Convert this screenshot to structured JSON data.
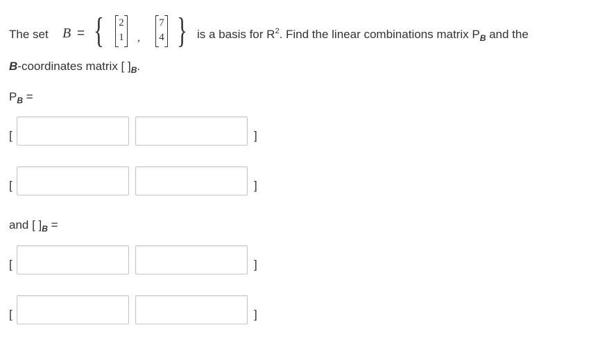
{
  "question": {
    "prefix": "The set",
    "set_symbol": "B",
    "equals": "=",
    "vector1": [
      "2",
      "1"
    ],
    "vector2": [
      "7",
      "4"
    ],
    "comma": ",",
    "basis_text_1": "is a basis for R",
    "basis_sup": "2",
    "basis_text_2": ".  Find the linear combinations matrix P",
    "basis_sub": "B",
    "basis_text_3": " and the",
    "line2_b": "B",
    "line2_text": "-coordinates matrix [ ]",
    "line2_sub": "B",
    "line2_end": "."
  },
  "pb_label": {
    "p": "P",
    "sub": "B",
    "eq": " ="
  },
  "coord_label": {
    "text": "and [ ]",
    "sub": "B",
    "eq": " ="
  },
  "brackets": {
    "open": "[",
    "close": "]"
  },
  "inputs": {
    "pb_r1c1": "",
    "pb_r1c2": "",
    "pb_r2c1": "",
    "pb_r2c2": "",
    "cb_r1c1": "",
    "cb_r1c2": "",
    "cb_r2c1": "",
    "cb_r2c2": ""
  }
}
